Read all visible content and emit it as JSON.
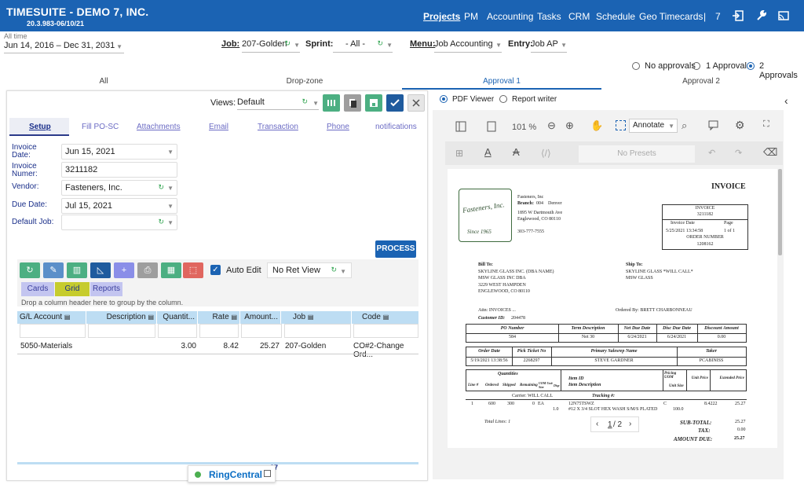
{
  "app": {
    "title": "TIMESUITE - DEMO 7, INC.",
    "version": "20.3.983-06/10/21"
  },
  "nav": [
    "Projects",
    "PM",
    "Accounting",
    "Tasks",
    "CRM",
    "Schedule",
    "Geo Timecards",
    "|",
    "7"
  ],
  "filters": {
    "date_label": "All time",
    "date_value": "Jun 14, 2016 – Dec 31, 2031",
    "job_label": "Job:",
    "job_value": "207-Golden",
    "sprint_label": "Sprint:",
    "sprint_value": "- All -",
    "menu_label": "Menu:",
    "menu_value": "Job Accounting",
    "entry_label": "Entry:",
    "entry_value": "Job AP"
  },
  "approvals": [
    "No approvals",
    "1 Approval",
    "2 Approvals"
  ],
  "tabs": [
    "All",
    "Drop-zone",
    "Approval 1",
    "Approval 2"
  ],
  "views": {
    "label": "Views:",
    "value": "Default"
  },
  "subtabs": [
    "Setup",
    "Fill PO-SC",
    "Attachments",
    "Email",
    "Transaction",
    "Phone",
    "notifications"
  ],
  "form": {
    "invoice_date_label": "Invoice Date:",
    "invoice_date": "Jun 15, 2021",
    "invoice_number_label": "Invoice Numer:",
    "invoice_number": "3211182",
    "vendor_label": "Vendor:",
    "vendor": "Fasteners, Inc.",
    "due_date_label": "Due Date:",
    "due_date": "Jul 15, 2021",
    "default_job_label": "Default Job:",
    "default_job": ""
  },
  "process_label": "PROCESS",
  "auto_edit_label": "Auto Edit",
  "ret_view": "No Ret View",
  "view_modes": [
    "Cards",
    "Grid",
    "Reports"
  ],
  "group_hint": "Drop a column header here to group by the column.",
  "grid": {
    "columns": [
      "G/L Account",
      "Description",
      "Quantit...",
      "Rate",
      "Amount...",
      "Job",
      "Code"
    ],
    "row": [
      "5050-Materials",
      "",
      "3.00",
      "8.42",
      "25.27",
      "207-Golden",
      "CO#2-Change Ord..."
    ],
    "footer_value": "27"
  },
  "ringcentral": "RingCentral",
  "viewer": {
    "pdf": "PDF Viewer",
    "report": "Report writer",
    "zoom": "101 %",
    "annotate": "Annotate",
    "presets": "No Presets",
    "page": "1",
    "pages": "/ 2"
  },
  "invoice": {
    "title": "INVOICE",
    "logo_text": "Fasteners, Inc.",
    "logo_since": "Since 1965",
    "company": "Fasteners, Inc",
    "branch_label": "Branch:",
    "branch": "004",
    "branch_city": "Denver",
    "addr1": "1895 W Dartmouth Ave",
    "addr2": "Englewood, CO 80110",
    "phone": "303-777-7555",
    "box_invoice": "INVOICE",
    "box_invoice_no": "3211182",
    "box_invoice_date_label": "Invoice Date",
    "box_page_label": "Page",
    "box_invoice_date": "5/25/2021 13:34:58",
    "box_page": "1 of 1",
    "box_order_label": "ORDER NUMBER",
    "box_order": "1208162",
    "bill_to_label": "Bill To:",
    "bill1": "SKYLINE GLASS INC. (DBA NAME)",
    "bill2": "MSW GLASS INC DBA",
    "bill3": "3229 WEST HAMPDEN",
    "bill4": "ENGLEWOOD, CO 80110",
    "ship_to_label": "Ship To:",
    "ship1": "SKYLINE GLASS *WILL CALL*",
    "ship2": "MSW GLASS",
    "attn": "Attn: INVOICES ...",
    "ordered_by": "Ordered By: BRETT CHARBONNEAU",
    "customer_id_label": "Customer ID:",
    "customer_id": "204478",
    "po_h": [
      "PO Number",
      "Term Description",
      "Net Due Date",
      "Disc Due Date",
      "Discount Amount"
    ],
    "po_v": [
      "584",
      "Net 30",
      "6/24/2021",
      "6/24/2021",
      "0.00"
    ],
    "ord_h": [
      "Order Date",
      "Pick Ticket No",
      "Primary Salesrep Name",
      "Taker"
    ],
    "ord_v": [
      "5/19/2021 13:38:56",
      "2268297",
      "STEVE GARDNER",
      "PCABINISS"
    ],
    "qty_label": "Quantities",
    "line_h": [
      "Line #",
      "Ordered",
      "Shipped",
      "Remaining",
      "UOM Unit Size",
      "Disp"
    ],
    "item_h": "Item ID",
    "item_desc_h": "Item Description",
    "pricing_h": "Pricing UOM",
    "unit_size_h": "Unit Size",
    "unit_price_h": "Unit Price",
    "ext_price_h": "Extended Price",
    "carrier": "Carrier:  WILL CALL",
    "tracking": "Tracking #:",
    "line": [
      "1",
      "600",
      "300",
      "0",
      "EA",
      "12N75TSWZ",
      "C",
      "8.4222",
      "25.27"
    ],
    "line_desc": "#12 X 3/4 SLOT HEX WASH S/M/S PLATED",
    "line_size": "1.0",
    "line_qty": "100.0",
    "total_lines": "Total Lines:  1",
    "subtotal_label": "SUB-TOTAL:",
    "subtotal": "25.27",
    "tax_label": "TAX:",
    "tax": "0.00",
    "amount_due_label": "AMOUNT DUE:",
    "amount_due": "25.27"
  },
  "colors": {
    "brand": "#1b63b3",
    "green": "#4caf82",
    "darkblue": "#1f5b9e",
    "purple": "#8a8ee8",
    "gray": "#9e9e9e",
    "red": "#e0665f"
  }
}
